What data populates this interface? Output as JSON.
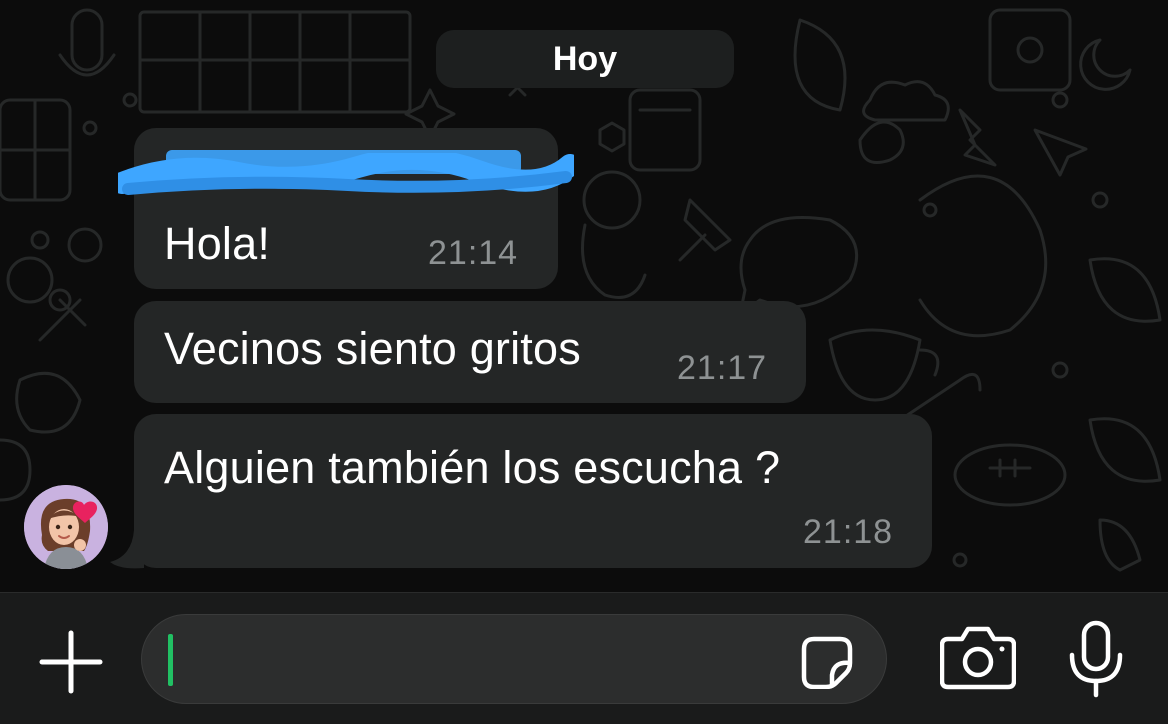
{
  "chat": {
    "date_separator": "Hoy",
    "messages": [
      {
        "text": "Hola!",
        "time": "21:14",
        "sender_redacted": true
      },
      {
        "text": "Vecinos siento gritos",
        "time": "21:17"
      },
      {
        "text": "Alguien también los escucha ?",
        "time": "21:18"
      }
    ]
  },
  "composer": {
    "input_value": "",
    "icons": [
      "plus-icon",
      "sticker-icon",
      "camera-icon",
      "microphone-icon"
    ]
  },
  "colors": {
    "background": "#0c0c0c",
    "bubble": "#242626",
    "timestamp": "#8e9293",
    "redaction": "#3ea6ff",
    "caret": "#21c063"
  }
}
